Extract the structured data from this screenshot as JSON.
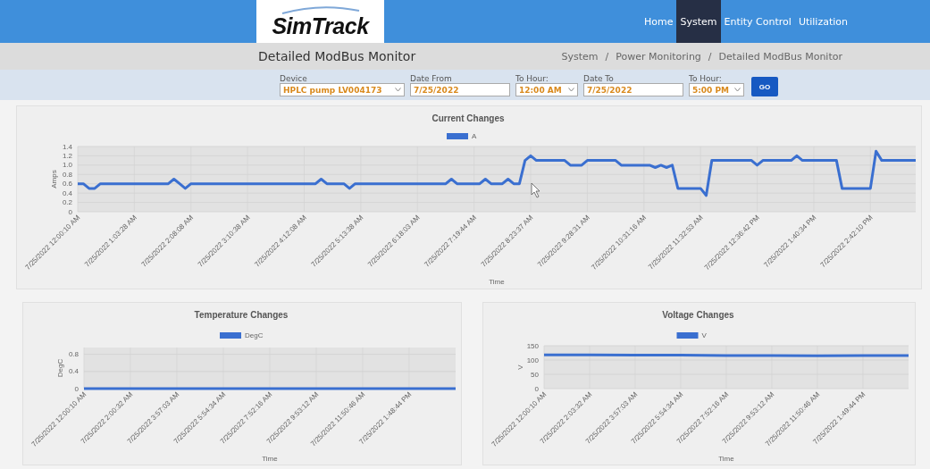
{
  "header": {
    "logo": "SimTrack",
    "nav": [
      {
        "label": "Home",
        "selected": false
      },
      {
        "label": "System",
        "selected": true
      },
      {
        "label": "Entity Control",
        "selected": false
      },
      {
        "label": "Utilization",
        "selected": false
      }
    ]
  },
  "page_title": "Detailed ModBus Monitor",
  "breadcrumb": [
    "System",
    "Power Monitoring",
    "Detailed ModBus Monitor"
  ],
  "breadcrumb_separator": "/",
  "filters": [
    {
      "kind": "select",
      "label": "Device",
      "value": "HPLC pump LV004173"
    },
    {
      "kind": "date",
      "label": "Date From",
      "value": "7/25/2022"
    },
    {
      "kind": "select",
      "label": "To Hour:",
      "value": "12:00 AM"
    },
    {
      "kind": "date",
      "label": "Date To",
      "value": "7/25/2022"
    },
    {
      "kind": "select",
      "label": "To Hour:",
      "value": "5:00 PM"
    }
  ],
  "go_button": "GO",
  "charts": [
    {
      "chart_data": {
        "type": "line",
        "title": "Current Changes",
        "xlabel": "Time",
        "ylabel": "Amps",
        "categories": [
          "7/25/2022 12:00:10 AM",
          null,
          null,
          null,
          null,
          null,
          null,
          null,
          null,
          null,
          "7/25/2022 1:03:28 AM",
          null,
          null,
          null,
          null,
          null,
          null,
          null,
          null,
          null,
          "7/25/2022 2:08:08 AM",
          null,
          null,
          null,
          null,
          null,
          null,
          null,
          null,
          null,
          "7/25/2022 3:10:38 AM",
          null,
          null,
          null,
          null,
          null,
          null,
          null,
          null,
          null,
          "7/25/2022 4:12:08 AM",
          null,
          null,
          null,
          null,
          null,
          null,
          null,
          null,
          null,
          "7/25/2022 5:13:38 AM",
          null,
          null,
          null,
          null,
          null,
          null,
          null,
          null,
          null,
          "7/25/2022 6:18:03 AM",
          null,
          null,
          null,
          null,
          null,
          null,
          null,
          null,
          null,
          "7/25/2022 7:19:44 AM",
          null,
          null,
          null,
          null,
          null,
          null,
          null,
          null,
          null,
          "7/25/2022 8:23:37 AM",
          null,
          null,
          null,
          null,
          null,
          null,
          null,
          null,
          null,
          "7/25/2022 9:28:31 AM",
          null,
          null,
          null,
          null,
          null,
          null,
          null,
          null,
          null,
          "7/25/2022 10:31:16 AM",
          null,
          null,
          null,
          null,
          null,
          null,
          null,
          null,
          null,
          "7/25/2022 11:32:53 AM",
          null,
          null,
          null,
          null,
          null,
          null,
          null,
          null,
          null,
          "7/25/2022 12:36:42 PM",
          null,
          null,
          null,
          null,
          null,
          null,
          null,
          null,
          null,
          "7/25/2022 1:40:34 PM",
          null,
          null,
          null,
          null,
          null,
          null,
          null,
          null,
          null,
          "7/25/2022 2:42:10 PM",
          null,
          null,
          null,
          null,
          null,
          null,
          null,
          null
        ],
        "series": [
          {
            "name": "A",
            "color": "#3a6fd0",
            "values": [
              0.6,
              0.6,
              0.5,
              0.5,
              0.6,
              0.6,
              0.6,
              0.6,
              0.6,
              0.6,
              0.6,
              0.6,
              0.6,
              0.6,
              0.6,
              0.6,
              0.6,
              0.7,
              0.6,
              0.5,
              0.6,
              0.6,
              0.6,
              0.6,
              0.6,
              0.6,
              0.6,
              0.6,
              0.6,
              0.6,
              0.6,
              0.6,
              0.6,
              0.6,
              0.6,
              0.6,
              0.6,
              0.6,
              0.6,
              0.6,
              0.6,
              0.6,
              0.6,
              0.7,
              0.6,
              0.6,
              0.6,
              0.6,
              0.5,
              0.6,
              0.6,
              0.6,
              0.6,
              0.6,
              0.6,
              0.6,
              0.6,
              0.6,
              0.6,
              0.6,
              0.6,
              0.6,
              0.6,
              0.6,
              0.6,
              0.6,
              0.7,
              0.6,
              0.6,
              0.6,
              0.6,
              0.6,
              0.7,
              0.6,
              0.6,
              0.6,
              0.7,
              0.6,
              0.6,
              1.1,
              1.2,
              1.1,
              1.1,
              1.1,
              1.1,
              1.1,
              1.1,
              1.0,
              1.0,
              1.0,
              1.1,
              1.1,
              1.1,
              1.1,
              1.1,
              1.1,
              1.0,
              1.0,
              1.0,
              1.0,
              1.0,
              1.0,
              0.95,
              1.0,
              0.95,
              1.0,
              0.5,
              0.5,
              0.5,
              0.5,
              0.5,
              0.35,
              1.1,
              1.1,
              1.1,
              1.1,
              1.1,
              1.1,
              1.1,
              1.1,
              1.0,
              1.1,
              1.1,
              1.1,
              1.1,
              1.1,
              1.1,
              1.2,
              1.1,
              1.1,
              1.1,
              1.1,
              1.1,
              1.1,
              1.1,
              0.5,
              0.5,
              0.5,
              0.5,
              0.5,
              0.5,
              1.3,
              1.1,
              1.1,
              1.1,
              1.1,
              1.1,
              1.1,
              1.1
            ]
          }
        ],
        "grid": true,
        "ylim": [
          0,
          1.4
        ],
        "yticks": [
          0,
          0.2,
          0.4,
          0.6,
          0.8,
          {
            "value": 1.0,
            "label": "1.0"
          },
          1.2,
          1.4
        ]
      }
    },
    {
      "chart_data": {
        "type": "line",
        "title": "Temperature Changes",
        "xlabel": "Time",
        "ylabel": "DegC",
        "categories": [
          "7/25/2022 12:00:10 AM",
          "7/25/2022 2:00:32 AM",
          "7/25/2022 3:57:03 AM",
          "7/25/2022 5:54:34 AM",
          "7/25/2022 7:52:16 AM",
          "7/25/2022 9:53:12 AM",
          "7/25/2022 11:50:46 AM",
          "7/25/2022 1:48:44 PM",
          null
        ],
        "series": [
          {
            "name": "DegC",
            "color": "#3a6fd0",
            "values": [
              0,
              0,
              0,
              0,
              0,
              0,
              0,
              0,
              0
            ]
          }
        ],
        "grid": true,
        "ylim": [
          0,
          0.96
        ],
        "yticks": [
          0,
          0.4,
          0.8
        ]
      }
    },
    {
      "chart_data": {
        "type": "line",
        "title": "Voltage Changes",
        "xlabel": "Time",
        "ylabel": "V",
        "categories": [
          "7/25/2022 12:00:10 AM",
          "7/25/2022 2:03:32 AM",
          "7/25/2022 3:57:03 AM",
          "7/25/2022 5:54:34 AM",
          "7/25/2022 7:52:16 AM",
          "7/25/2022 9:53:12 AM",
          "7/25/2022 11:50:46 AM",
          "7/25/2022 1:49:44 PM",
          null
        ],
        "series": [
          {
            "name": "V",
            "color": "#3a6fd0",
            "values": [
              118,
              118,
              117,
              117,
              116,
              116,
              115,
              116,
              116
            ]
          }
        ],
        "grid": true,
        "ylim": [
          0,
          150
        ],
        "yticks": [
          0,
          50,
          100,
          150
        ]
      }
    }
  ]
}
